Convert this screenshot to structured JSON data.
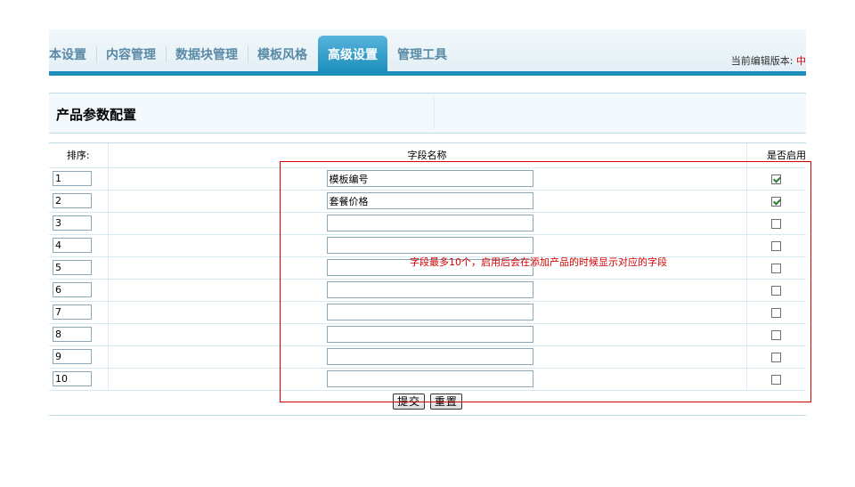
{
  "nav": {
    "tabs": [
      {
        "label": "本设置",
        "active": false
      },
      {
        "label": "内容管理",
        "active": false
      },
      {
        "label": "数据块管理",
        "active": false
      },
      {
        "label": "模板风格",
        "active": false
      },
      {
        "label": "高级设置",
        "active": true
      },
      {
        "label": "管理工具",
        "active": false
      }
    ],
    "version_label": "当前编辑版本:",
    "version_value": "中"
  },
  "panel": {
    "title": "产品参数配置"
  },
  "table": {
    "headers": {
      "order": "排序:",
      "field": "字段名称",
      "enabled": "是否启用"
    },
    "rows": [
      {
        "order": "1",
        "name": "模板编号",
        "enabled": true
      },
      {
        "order": "2",
        "name": "套餐价格",
        "enabled": true
      },
      {
        "order": "3",
        "name": "",
        "enabled": false
      },
      {
        "order": "4",
        "name": "",
        "enabled": false
      },
      {
        "order": "5",
        "name": "",
        "enabled": false
      },
      {
        "order": "6",
        "name": "",
        "enabled": false
      },
      {
        "order": "7",
        "name": "",
        "enabled": false
      },
      {
        "order": "8",
        "name": "",
        "enabled": false
      },
      {
        "order": "9",
        "name": "",
        "enabled": false
      },
      {
        "order": "10",
        "name": "",
        "enabled": false
      }
    ]
  },
  "buttons": {
    "submit": "提交",
    "reset": "重置"
  },
  "annotation": {
    "text": "字段最多10个，启用后会在添加产品的时候显示对应的字段",
    "color": "#d40000"
  },
  "colors": {
    "accent": "#1e8fbd",
    "tab_active": "#3aa3cf"
  }
}
